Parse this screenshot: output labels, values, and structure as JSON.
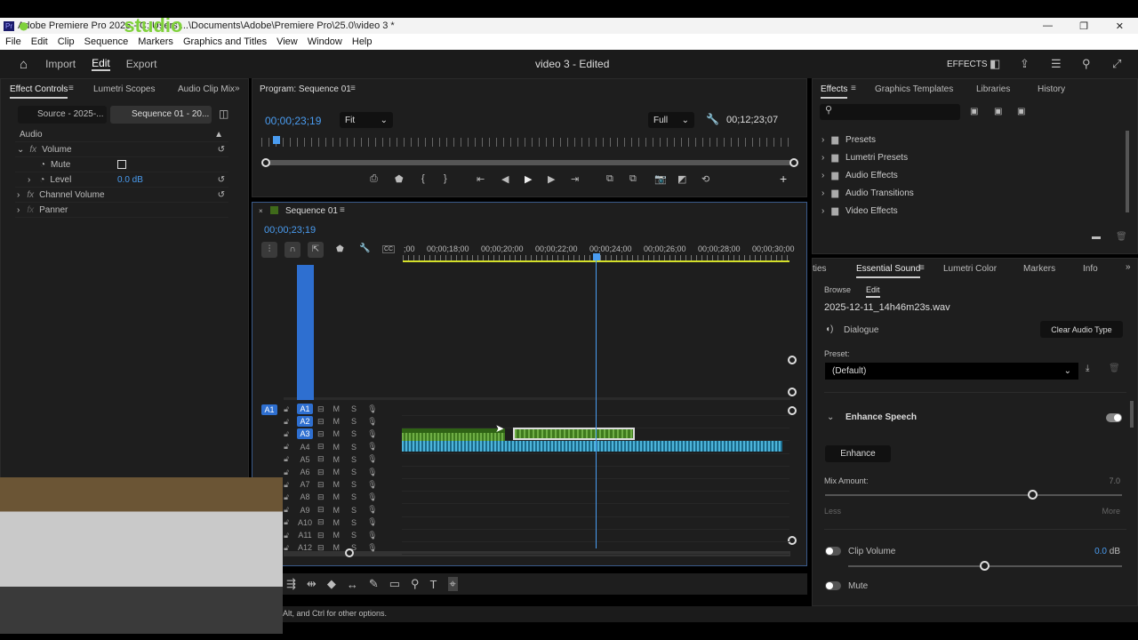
{
  "window": {
    "title": "Adobe Premiere Pro 2025 - C:\\Users\\...\\Documents\\Adobe\\Premiere Pro\\25.0\\video 3 *",
    "watermark": "studio"
  },
  "menu": [
    "File",
    "Edit",
    "Clip",
    "Sequence",
    "Markers",
    "Graphics and Titles",
    "View",
    "Window",
    "Help"
  ],
  "header": {
    "nav": [
      "Import",
      "Edit",
      "Export"
    ],
    "project_title": "video 3 - Edited",
    "workspace_label": "EFFECTS"
  },
  "effect_controls": {
    "tabs": [
      "Effect Controls",
      "Lumetri Scopes",
      "Audio Clip Mix"
    ],
    "source_tab": "Source - 2025-...",
    "sequence_tab": "Sequence 01 - 20...",
    "section": "Audio",
    "rows": [
      {
        "label": "Volume",
        "fx": "fx"
      },
      {
        "label": "Mute"
      },
      {
        "label": "Level",
        "value": "0.0 dB"
      },
      {
        "label": "Channel Volume",
        "fx": "fx"
      },
      {
        "label": "Panner",
        "fx": "fx"
      }
    ]
  },
  "program": {
    "title": "Program: Sequence 01",
    "timecode": "00;00;23;19",
    "zoom": "Fit",
    "quality": "Full",
    "duration": "00;12;23;07"
  },
  "timeline": {
    "title": "Sequence 01",
    "timecode": "00;00;23;19",
    "ruler": [
      ";00",
      "00;00;18;00",
      "00;00;20;00",
      "00;00;22;00",
      "00;00;24;00",
      "00;00;26;00",
      "00;00;28;00",
      "00;00;30;00"
    ],
    "source_patch": "A1",
    "tracks": [
      "A1",
      "A2",
      "A3",
      "A4",
      "A5",
      "A6",
      "A7",
      "A8",
      "A9",
      "A10",
      "A11",
      "A12"
    ],
    "mute": "M",
    "solo": "S"
  },
  "effects_panel": {
    "tabs": [
      "Effects",
      "Graphics Templates",
      "Libraries",
      "History"
    ],
    "search_placeholder": "",
    "items": [
      "Presets",
      "Lumetri Presets",
      "Audio Effects",
      "Audio Transitions",
      "Video Effects"
    ]
  },
  "essential_sound": {
    "tabs": [
      "ties",
      "Essential Sound",
      "Lumetri Color",
      "Markers",
      "Info"
    ],
    "subtabs": [
      "Browse",
      "Edit"
    ],
    "filename": "2025-12-11_14h46m23s.wav",
    "audio_type": "Dialogue",
    "clear_button": "Clear Audio Type",
    "preset_label": "Preset:",
    "preset_value": "(Default)",
    "enhance_section": "Enhance Speech",
    "enhance_enabled": true,
    "enhance_button": "Enhance",
    "mix_label": "Mix Amount:",
    "mix_value": "7.0",
    "mix_fraction": 0.7,
    "less": "Less",
    "more": "More",
    "clip_volume_label": "Clip Volume",
    "clip_volume_value": "0.0",
    "clip_volume_unit": "dB",
    "clip_volume_fraction": 0.5,
    "mute_label": "Mute"
  },
  "status": {
    "text": "Alt, and Ctrl for other options."
  },
  "colors": {
    "accent": "#4a9cf0",
    "audio_clip_green": "#3f7a1e",
    "audio_clip_blue": "#1b6a8a",
    "playhead": "#4a9cf0"
  }
}
